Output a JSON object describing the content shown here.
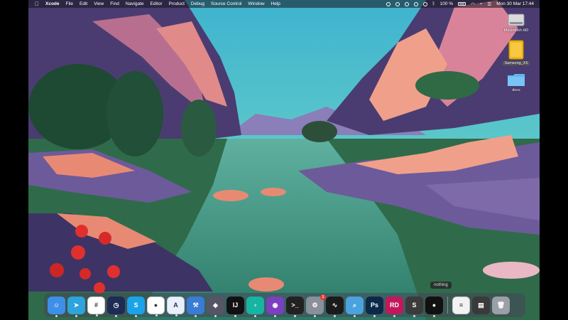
{
  "menubar": {
    "app_name": "Xcode",
    "menus": [
      "File",
      "Edit",
      "View",
      "Find",
      "Navigate",
      "Editor",
      "Product",
      "Debug",
      "Source Control",
      "Window",
      "Help"
    ],
    "status": {
      "battery": "100 %",
      "datetime": "Mon 30 Mar 17:44"
    }
  },
  "desktop": {
    "icons": [
      {
        "label": "Macintosh HD",
        "kind": "hard-drive",
        "selected": false
      },
      {
        "label": "Samsung_X5",
        "kind": "external-drive",
        "selected": true
      },
      {
        "label": "docs",
        "kind": "folder",
        "selected": false
      }
    ]
  },
  "tooltip": "nothing",
  "dock": {
    "apps": [
      {
        "name": "Finder",
        "icon": "finder-icon",
        "color": "#3d8fe8",
        "glyph": "☺",
        "running": true
      },
      {
        "name": "Telegram",
        "icon": "telegram-icon",
        "color": "#2ea3dc",
        "glyph": "➤",
        "running": true
      },
      {
        "name": "Slack",
        "icon": "slack-icon",
        "color": "#ffffff",
        "glyph": "#",
        "running": true
      },
      {
        "name": "Time Machine",
        "icon": "clock-icon",
        "color": "#1e2b55",
        "glyph": "◷",
        "running": true
      },
      {
        "name": "Skype",
        "icon": "skype-icon",
        "color": "#1aa3e8",
        "glyph": "S",
        "running": true
      },
      {
        "name": "Chrome",
        "icon": "chrome-icon",
        "color": "#ffffff",
        "glyph": "●",
        "running": true
      },
      {
        "name": "Xcode Helper",
        "icon": "blueprint-icon",
        "color": "#e8f0ff",
        "glyph": "A",
        "running": true
      },
      {
        "name": "Xcode",
        "icon": "xcode-icon",
        "color": "#3a7bd5",
        "glyph": "⚒",
        "running": true
      },
      {
        "name": "Unity",
        "icon": "unity-icon",
        "color": "#555566",
        "glyph": "◆",
        "running": true
      },
      {
        "name": "IntelliJ IDEA",
        "icon": "intellij-icon",
        "color": "#111111",
        "glyph": "IJ",
        "running": true
      },
      {
        "name": "GitKraken",
        "icon": "gitkraken-icon",
        "color": "#17b3a3",
        "glyph": "♆",
        "running": true
      },
      {
        "name": "GitHub Desktop",
        "icon": "github-icon",
        "color": "#7b3fbf",
        "glyph": "◉",
        "running": true
      },
      {
        "name": "Terminal",
        "icon": "terminal-icon",
        "color": "#222222",
        "glyph": ">_",
        "running": true
      },
      {
        "name": "System Preferences",
        "icon": "gear-icon",
        "color": "#8a8f99",
        "glyph": "⚙",
        "running": true,
        "badge": "1"
      },
      {
        "name": "Activity Monitor",
        "icon": "activity-monitor-icon",
        "color": "#1b1b1b",
        "glyph": "∿",
        "running": true
      },
      {
        "name": "Preview",
        "icon": "magnifier-icon",
        "color": "#4aa3df",
        "glyph": "⌕",
        "running": true
      },
      {
        "name": "Photoshop",
        "icon": "photoshop-icon",
        "color": "#0b2a4a",
        "glyph": "Ps",
        "running": true
      },
      {
        "name": "Rider",
        "icon": "rider-icon",
        "color": "#c2185b",
        "glyph": "RD",
        "running": true
      },
      {
        "name": "Sublime Text",
        "icon": "sublime-icon",
        "color": "#3b3b3b",
        "glyph": "S",
        "running": true
      },
      {
        "name": "Screen Recorder",
        "icon": "recorder-icon",
        "color": "#111111",
        "glyph": "●",
        "running": true
      }
    ],
    "others": [
      {
        "name": "Document",
        "icon": "document-icon",
        "color": "#f2f2f2",
        "glyph": "≡"
      },
      {
        "name": "Archive",
        "icon": "archive-icon",
        "color": "#3a3a3a",
        "glyph": "▤"
      },
      {
        "name": "Trash",
        "icon": "trash-icon",
        "color": "#9aa0a6",
        "glyph": "🗑"
      }
    ]
  },
  "colors": {
    "sky": "#4fc7c9",
    "water": "#3f9e86",
    "rock_pink": "#e88a73",
    "rock_purple": "#6d5a9a",
    "foliage": "#1f3f2a"
  }
}
